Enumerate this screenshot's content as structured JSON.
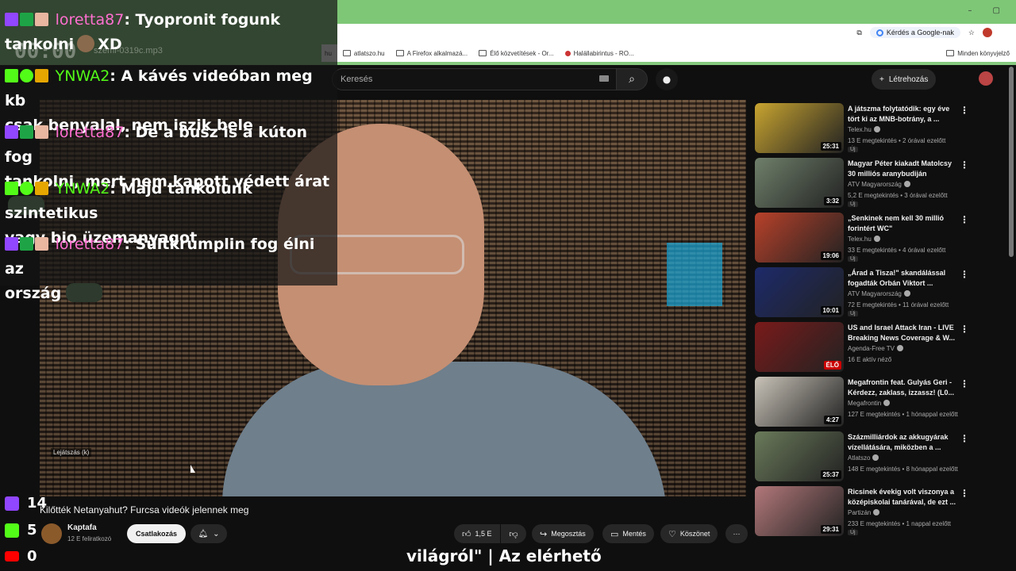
{
  "browser": {
    "bookmarks": [
      "hu",
      "atlatszo.hu",
      "A Firefox alkalmazá...",
      "Élő közvetítések - Or...",
      "Halállabirintus - RO..."
    ],
    "google_chip": "Kérdés a Google-nak",
    "bookmarks_right": "Minden könyvjelző",
    "window_min": "–",
    "window_max": "▢"
  },
  "youtube": {
    "search_placeholder": "Keresés",
    "create_label": "Létrehozás"
  },
  "player_overlay": {
    "timer": "00:00",
    "file": "szemi-0319c.mp3",
    "time_display": "00:00:00 / 00:04:40"
  },
  "chat": [
    {
      "user": "loretta87",
      "text": ": Tyopronit fogunk",
      "line2": "tankolni",
      "line2_suffix": "XD"
    },
    {
      "user": "YNWA2",
      "text": ": A kávés videóban meg kb",
      "line2": "csak benyalal, nem iszik bele"
    },
    {
      "user": "loretta87",
      "text": ": De a busz is a kúton fog",
      "line2": "tankolni, mert nem kapott védett árat"
    },
    {
      "user": "YNWA2",
      "text": ": Majd tankolunk szintetikus",
      "line2": "vagy bio üzemanyagot"
    },
    {
      "user": "loretta87",
      "text": ": Sültkrumplin fog élni az",
      "line2": "ország"
    }
  ],
  "stats": {
    "twitch": "14",
    "kick": "5",
    "youtube": "0"
  },
  "video": {
    "overlay_label": "Lejátszás (k)",
    "title": "Kilőtték Netanyahut? Furcsa videók jelennek meg",
    "channel": "Kaptafa",
    "subscribers": "12 E feliratkozó",
    "join": "Csatlakozás",
    "likes": "1,5 E",
    "share": "Megosztás",
    "save": "Mentés",
    "thanks": "Köszönet",
    "more": "···"
  },
  "ticker": "világról\" | Az elérhető",
  "recommendations": [
    {
      "title": "A játszma folytatódik: egy éve tört ki az MNB-botrány, a ...",
      "channel": "Telex.hu",
      "meta": "13 E megtekintés • 2 órával ezelőtt",
      "badge": "Új",
      "duration": "25:31",
      "color": "#c8a430"
    },
    {
      "title": "Magyar Péter kiakadt Matolcsy 30 milliós aranybudiján",
      "channel": "ATV Magyarország",
      "meta": "5,2 E megtekintés • 3 órával ezelőtt",
      "badge": "Új",
      "duration": "3:32",
      "color": "#6f7f6a"
    },
    {
      "title": "„Senkinek nem kell 30 millió forintért WC\"",
      "channel": "Telex.hu",
      "meta": "33 E megtekintés • 4 órával ezelőtt",
      "badge": "Új",
      "duration": "19:06",
      "color": "#b8412a"
    },
    {
      "title": "„Árad a Tisza!\" skandálással fogadták Orbán Viktort ...",
      "channel": "ATV Magyarország",
      "meta": "72 E megtekintés • 11 órával ezelőtt",
      "badge": "Új",
      "duration": "10:01",
      "color": "#1d2a6a"
    },
    {
      "title": "US and Israel Attack Iran - LIVE Breaking News Coverage & W...",
      "channel": "Agenda-Free TV",
      "meta": "16 E aktív néző",
      "badge": "",
      "duration": "ÉLŐ",
      "color": "#7a1a1a"
    },
    {
      "title": "Megafrontin feat. Gulyás Geri - Kérdezz, zaklass, izzassz! (L0...",
      "channel": "Megafrontin",
      "meta": "127 E megtekintés • 1 hónappal ezelőtt",
      "badge": "",
      "duration": "4:27",
      "color": "#c9c3b8"
    },
    {
      "title": "Százmilliárdok az akkugyárak vízellátására, miközben a ...",
      "channel": "Atlatszo",
      "meta": "148 E megtekintés • 8 hónappal ezelőtt",
      "badge": "",
      "duration": "25:37",
      "color": "#6a7a5a"
    },
    {
      "title": "Ricsinek évekig volt viszonya a középiskolai tanárával, de ezt ...",
      "channel": "Partizán",
      "meta": "233 E megtekintés • 1 nappal ezelőtt",
      "badge": "Új",
      "duration": "29:31",
      "color": "#b3787a"
    }
  ],
  "colors": {
    "twitch": "#9146ff",
    "kick": "#53fc18",
    "youtube": "#ff0000",
    "loretta": "#ff6fd0",
    "ynwa": "#53fc18"
  }
}
